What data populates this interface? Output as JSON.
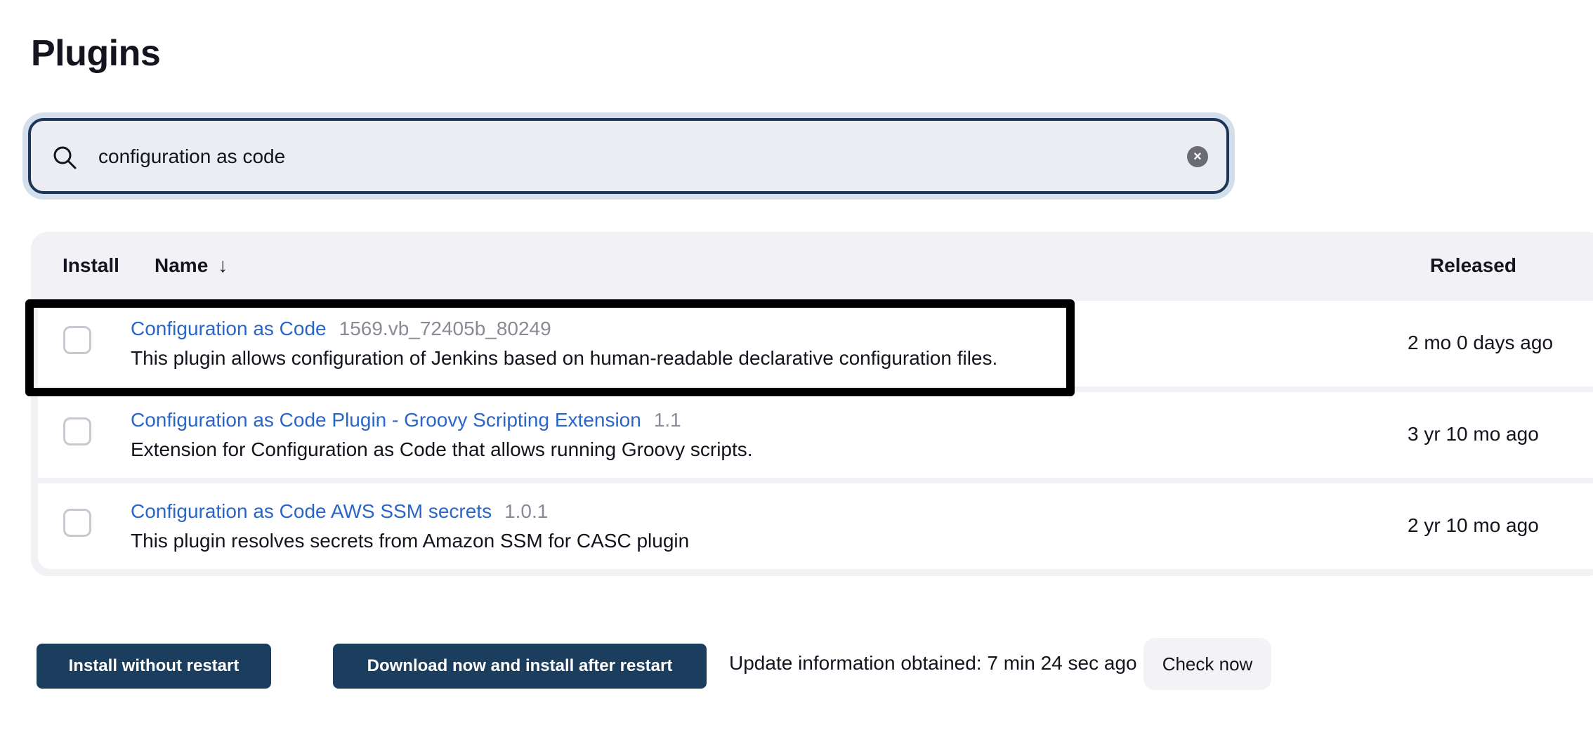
{
  "page": {
    "title": "Plugins"
  },
  "search": {
    "value": "configuration as code",
    "icon": "search-icon",
    "clear_icon": "clear-icon",
    "clear_glyph": "×"
  },
  "table": {
    "headers": {
      "install": "Install",
      "name": "Name",
      "name_sort_glyph": "↓",
      "released": "Released"
    },
    "rows": [
      {
        "name": "Configuration as Code",
        "version": "1569.vb_72405b_80249",
        "description": "This plugin allows configuration of Jenkins based on human-readable declarative configuration files.",
        "released": "2 mo 0 days ago",
        "checked": false,
        "highlighted": true
      },
      {
        "name": "Configuration as Code Plugin - Groovy Scripting Extension",
        "version": "1.1",
        "description": "Extension for Configuration as Code that allows running Groovy scripts.",
        "released": "3 yr 10 mo ago",
        "checked": false,
        "highlighted": false
      },
      {
        "name": "Configuration as Code AWS SSM secrets",
        "version": "1.0.1",
        "description": "This plugin resolves secrets from Amazon SSM for CASC plugin",
        "released": "2 yr 10 mo ago",
        "checked": false,
        "highlighted": false
      }
    ]
  },
  "footer": {
    "install_button": "Install without restart",
    "download_button": "Download now and install after restart",
    "update_info": "Update information obtained: 7 min 24 sec ago",
    "check_button": "Check now"
  },
  "colors": {
    "accent_navy": "#1b3d5e",
    "link_blue": "#2a66c9",
    "version_gray": "#8a8a96",
    "highlight_border": "#000000"
  }
}
